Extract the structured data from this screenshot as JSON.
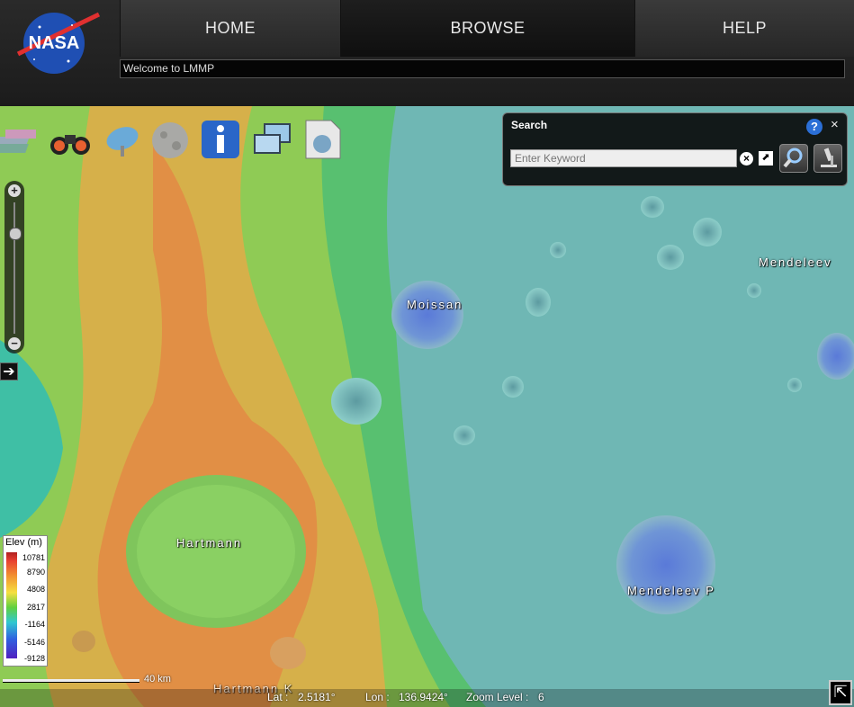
{
  "header": {
    "logo_text": "NASA",
    "nav": {
      "home": "HOME",
      "browse": "BROWSE",
      "help": "HELP"
    },
    "status": "Welcome to LMMP"
  },
  "toolbar": {
    "icons": [
      "layers-icon",
      "binoculars-icon",
      "satellite-dish-icon",
      "moon-icon",
      "info-icon",
      "monitors-icon",
      "www-document-icon"
    ]
  },
  "search": {
    "title": "Search",
    "help": "?",
    "close": "×",
    "placeholder": "Enter Keyword",
    "clear": "×",
    "expand": "⬈"
  },
  "map": {
    "labels": {
      "moissan": "Moissan",
      "mendeleev": "Mendeleev",
      "hartmann": "Hartmann",
      "mendeleev_p": "Mendeleev P",
      "hartmann_k": "Hartmann K"
    }
  },
  "zoom": {
    "plus": "+",
    "minus": "−"
  },
  "panel_toggle": "➔",
  "legend": {
    "title": "Elev (m)",
    "values": [
      "10781",
      "8790",
      "4808",
      "2817",
      "-1164",
      "-5146",
      "-9128"
    ]
  },
  "scale": {
    "label": "40 km"
  },
  "coords": {
    "lat_label": "Lat :",
    "lat_value": "2.5181°",
    "lon_label": "Lon :",
    "lon_value": "136.9424°",
    "zoom_label": "Zoom Level :",
    "zoom_value": "6"
  },
  "corner_button": "⇱",
  "colors": {
    "header": "#1c1c1c",
    "terrain_high": "#e08a40",
    "terrain_mid": "#6cc060",
    "terrain_low": "#6fb7b4"
  }
}
